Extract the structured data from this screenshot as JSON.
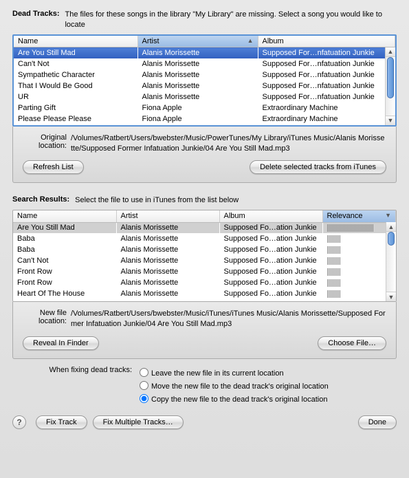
{
  "deadTracks": {
    "title": "Dead Tracks:",
    "desc": "The files for these songs in the library \"My Library\" are missing.  Select a song you would like to locate",
    "columns": {
      "name": "Name",
      "artist": "Artist",
      "album": "Album"
    },
    "rows": [
      {
        "name": "Are You Still Mad",
        "artist": "Alanis Morissette",
        "album": "Supposed For…nfatuation Junkie",
        "selected": true
      },
      {
        "name": "Can't Not",
        "artist": "Alanis Morissette",
        "album": "Supposed For…nfatuation Junkie"
      },
      {
        "name": "Sympathetic Character",
        "artist": "Alanis Morissette",
        "album": "Supposed For…nfatuation Junkie"
      },
      {
        "name": "That I Would Be Good",
        "artist": "Alanis Morissette",
        "album": "Supposed For…nfatuation Junkie"
      },
      {
        "name": "UR",
        "artist": "Alanis Morissette",
        "album": "Supposed For…nfatuation Junkie"
      },
      {
        "name": "Parting Gift",
        "artist": "Fiona Apple",
        "album": "Extraordinary Machine"
      },
      {
        "name": "Please Please Please",
        "artist": "Fiona Apple",
        "album": "Extraordinary Machine"
      }
    ],
    "origLabel": "Original location:",
    "origValue": "/Volumes/Ratbert/Users/bwebster/Music/PowerTunes/My Library/iTunes Music/Alanis Morissette/Supposed Former Infatuation Junkie/04 Are You Still Mad.mp3",
    "refreshBtn": "Refresh List",
    "deleteBtn": "Delete selected tracks from iTunes"
  },
  "searchResults": {
    "title": "Search Results:",
    "desc": "Select the file to use in iTunes from the list below",
    "columns": {
      "name": "Name",
      "artist": "Artist",
      "album": "Album",
      "relevance": "Relevance"
    },
    "rows": [
      {
        "name": "Are You Still Mad",
        "artist": "Alanis Morissette",
        "album": "Supposed Fo…ation Junkie",
        "rel": 100,
        "selected": true
      },
      {
        "name": "Baba",
        "artist": "Alanis Morissette",
        "album": "Supposed Fo…ation Junkie",
        "rel": 28
      },
      {
        "name": "Baba",
        "artist": "Alanis Morissette",
        "album": "Supposed Fo…ation Junkie",
        "rel": 28
      },
      {
        "name": "Can't Not",
        "artist": "Alanis Morissette",
        "album": "Supposed Fo…ation Junkie",
        "rel": 28
      },
      {
        "name": "Front Row",
        "artist": "Alanis Morissette",
        "album": "Supposed Fo…ation Junkie",
        "rel": 28
      },
      {
        "name": "Front Row",
        "artist": "Alanis Morissette",
        "album": "Supposed Fo…ation Junkie",
        "rel": 28
      },
      {
        "name": "Heart Of The House",
        "artist": "Alanis Morissette",
        "album": "Supposed Fo…ation Junkie",
        "rel": 28
      }
    ],
    "newLabel": "New file location:",
    "newValue": "/Volumes/Ratbert/Users/bwebster/Music/iTunes/iTunes Music/Alanis Morissette/Supposed Former Infatuation Junkie/04 Are You Still Mad.mp3",
    "revealBtn": "Reveal In Finder",
    "chooseBtn": "Choose File…"
  },
  "radios": {
    "label": "When fixing dead tracks:",
    "opts": [
      "Leave the new file in its current location",
      "Move the new file to the dead track's original location",
      "Copy the new file to the dead track's original location"
    ],
    "selected": 2
  },
  "bottom": {
    "help": "?",
    "fixTrack": "Fix Track",
    "fixMultiple": "Fix Multiple Tracks…",
    "done": "Done"
  }
}
